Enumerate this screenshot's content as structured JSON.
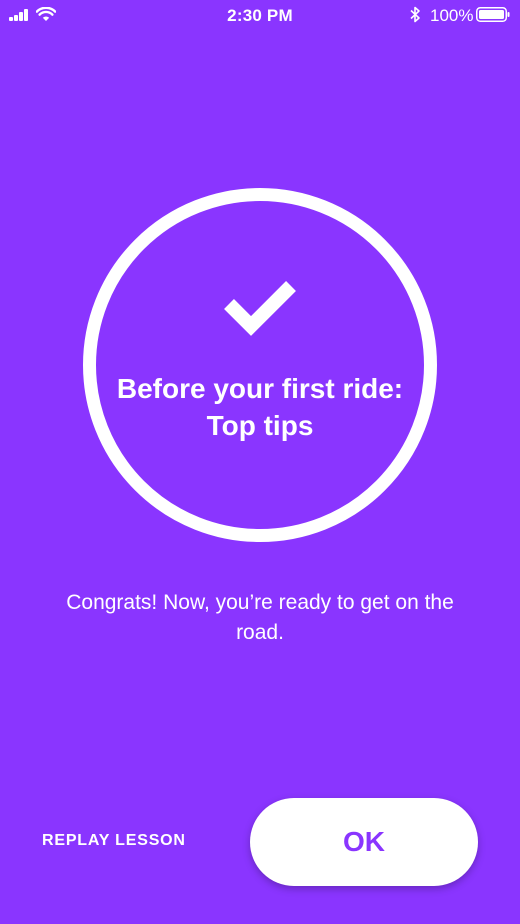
{
  "status_bar": {
    "time": "2:30 PM",
    "battery_percent": "100%",
    "signal_icon": "cellular-signal-icon",
    "wifi_icon": "wifi-icon",
    "bluetooth_icon": "bluetooth-icon",
    "battery_icon": "battery-icon"
  },
  "completion": {
    "icon": "checkmark-icon",
    "title": "Before your first ride: Top tips",
    "message": "Congrats! Now, you’re ready to get on the road."
  },
  "actions": {
    "replay_label": "REPLAY LESSON",
    "ok_label": "OK"
  },
  "colors": {
    "background": "#8a35ff",
    "foreground": "#ffffff",
    "button_text": "#8a35ff"
  }
}
